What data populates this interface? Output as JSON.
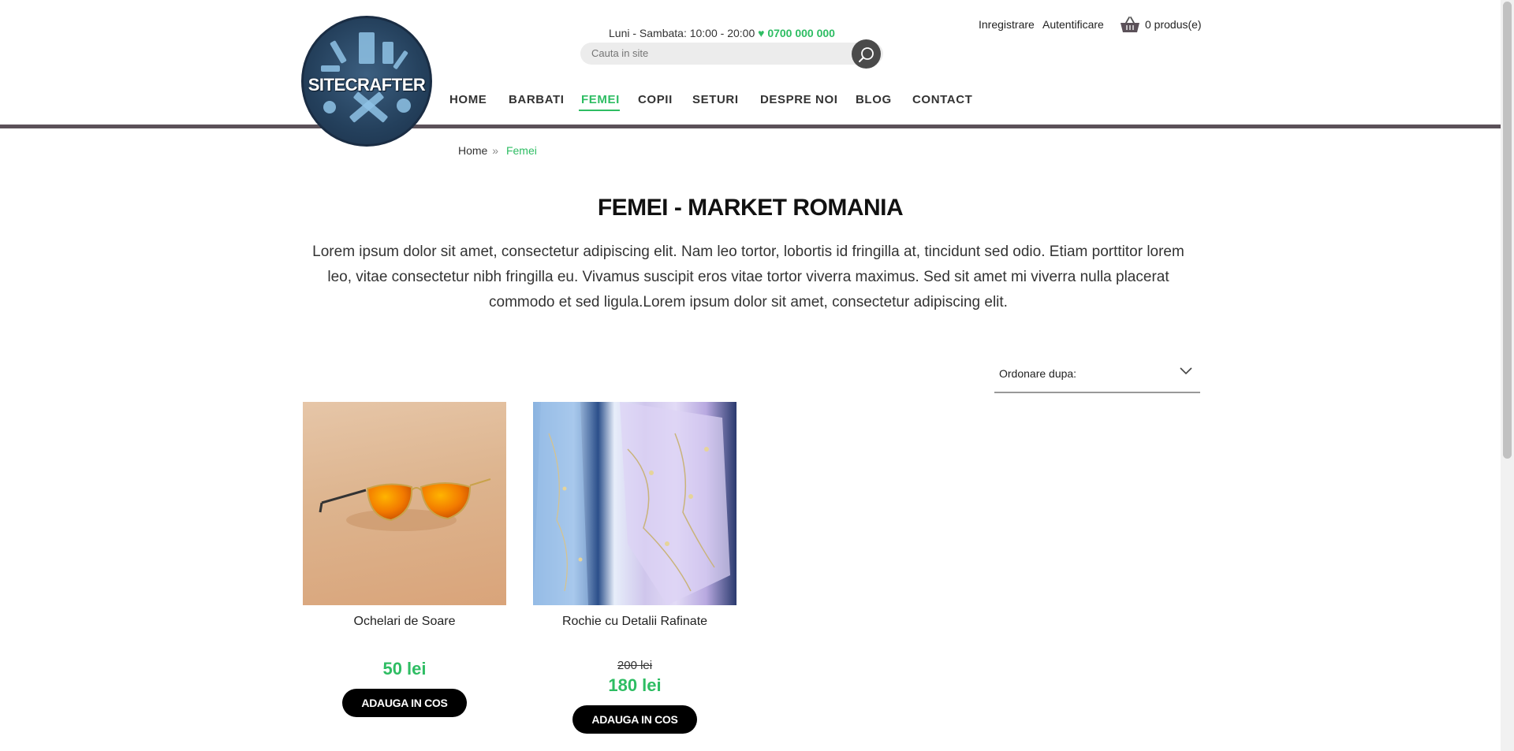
{
  "header": {
    "logo_text": "SITECRAFTER",
    "hours": "Luni - Sambata: 10:00 - 20:00",
    "phone_icon": "heart-icon",
    "phone": "0700 000 000",
    "search_placeholder": "Cauta in site",
    "register": "Inregistrare",
    "login": "Autentificare",
    "cart": "0 produs(e)"
  },
  "nav": {
    "items": [
      {
        "label": "HOME"
      },
      {
        "label": "BARBATI"
      },
      {
        "label": "FEMEI",
        "active": true
      },
      {
        "label": "COPII"
      },
      {
        "label": "SETURI"
      },
      {
        "label": "DESPRE NOI"
      },
      {
        "label": "BLOG"
      },
      {
        "label": "CONTACT"
      }
    ]
  },
  "breadcrumb": {
    "home": "Home",
    "separator": "»",
    "current": "Femei"
  },
  "category": {
    "title": "FEMEI - MARKET ROMANIA",
    "description": "Lorem ipsum dolor sit amet, consectetur adipiscing elit. Nam leo tortor, lobortis id fringilla at, tincidunt sed odio. Etiam porttitor lorem leo, vitae consectetur nibh fringilla eu. Vivamus suscipit eros vitae tortor viverra maximus. Sed sit amet mi viverra nulla placerat commodo et sed ligula.Lorem ipsum dolor sit amet, consectetur adipiscing elit."
  },
  "sort": {
    "label": "Ordonare dupa:"
  },
  "products": [
    {
      "name": "Ochelari de Soare",
      "old_price": "",
      "price": "50 lei",
      "button": "ADAUGA IN COS"
    },
    {
      "name": "Rochie cu Detalii Rafinate",
      "old_price": "200 lei",
      "price": "180 lei",
      "button": "ADAUGA IN COS"
    }
  ],
  "colors": {
    "accent": "#2ebd63",
    "divider": "#5b5159",
    "button": "#000000"
  }
}
